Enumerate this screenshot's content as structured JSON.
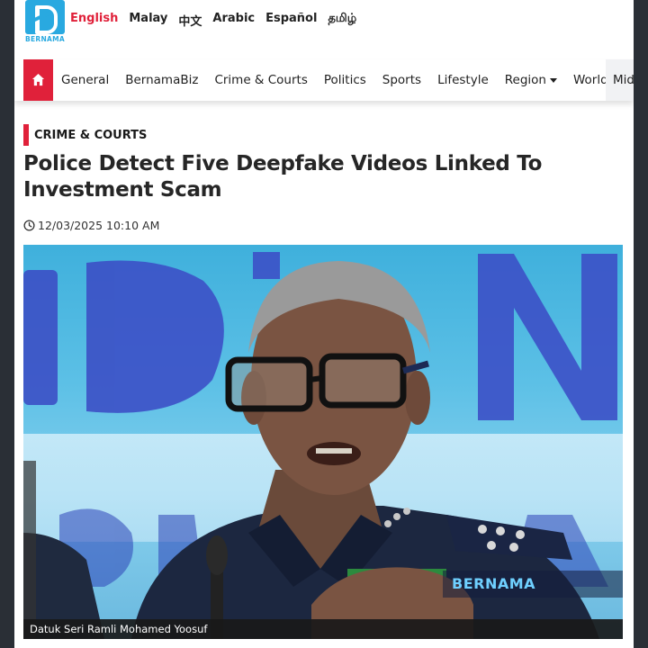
{
  "site": {
    "logo_text": "BERNAMA"
  },
  "languages": [
    {
      "label": "English",
      "active": true
    },
    {
      "label": "Malay"
    },
    {
      "label": "中文"
    },
    {
      "label": "Arabic"
    },
    {
      "label": "Español"
    },
    {
      "label": "தமிழ்"
    }
  ],
  "nav": {
    "home_icon": "home-icon",
    "items": [
      {
        "label": "General"
      },
      {
        "label": "BernamaBiz"
      },
      {
        "label": "Crime & Courts"
      },
      {
        "label": "Politics"
      },
      {
        "label": "Sports"
      },
      {
        "label": "Lifestyle"
      },
      {
        "label": "Region",
        "dropdown": true
      },
      {
        "label": "World",
        "dropdown": true
      }
    ],
    "overflow_label": "Mid"
  },
  "article": {
    "category": "CRIME & COURTS",
    "headline": "Police Detect Five Deepfake Videos Linked To Investment Scam",
    "datetime": "12/03/2025 10:10 AM",
    "photo_watermark": "BERNAMA",
    "photo_caption": "Datuk Seri Ramli Mohamed Yoosuf"
  },
  "colors": {
    "accent": "#e0213a",
    "brand_blue": "#29a9e0"
  }
}
